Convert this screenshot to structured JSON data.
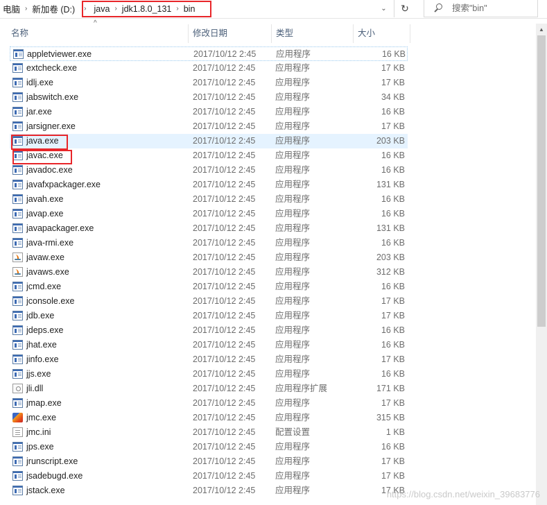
{
  "address": {
    "crumbs": [
      "电脑",
      "新加卷 (D:)",
      "java",
      "jdk1.8.0_131",
      "bin"
    ],
    "dropdown_glyph": "⌄",
    "refresh_glyph": "↻"
  },
  "search": {
    "placeholder": "搜索\"bin\""
  },
  "columns": {
    "name": "名称",
    "date": "修改日期",
    "type": "类型",
    "size": "大小"
  },
  "files": [
    {
      "name": "appletviewer.exe",
      "date": "2017/10/12 2:45",
      "type": "应用程序",
      "size": "16 KB",
      "icon": "exe-icon"
    },
    {
      "name": "extcheck.exe",
      "date": "2017/10/12 2:45",
      "type": "应用程序",
      "size": "17 KB",
      "icon": "exe-icon"
    },
    {
      "name": "idlj.exe",
      "date": "2017/10/12 2:45",
      "type": "应用程序",
      "size": "17 KB",
      "icon": "exe-icon"
    },
    {
      "name": "jabswitch.exe",
      "date": "2017/10/12 2:45",
      "type": "应用程序",
      "size": "34 KB",
      "icon": "exe-icon"
    },
    {
      "name": "jar.exe",
      "date": "2017/10/12 2:45",
      "type": "应用程序",
      "size": "16 KB",
      "icon": "exe-icon"
    },
    {
      "name": "jarsigner.exe",
      "date": "2017/10/12 2:45",
      "type": "应用程序",
      "size": "17 KB",
      "icon": "exe-icon"
    },
    {
      "name": "java.exe",
      "date": "2017/10/12 2:45",
      "type": "应用程序",
      "size": "203 KB",
      "icon": "exe-icon"
    },
    {
      "name": "javac.exe",
      "date": "2017/10/12 2:45",
      "type": "应用程序",
      "size": "16 KB",
      "icon": "exe-icon"
    },
    {
      "name": "javadoc.exe",
      "date": "2017/10/12 2:45",
      "type": "应用程序",
      "size": "16 KB",
      "icon": "exe-icon"
    },
    {
      "name": "javafxpackager.exe",
      "date": "2017/10/12 2:45",
      "type": "应用程序",
      "size": "131 KB",
      "icon": "exe-icon"
    },
    {
      "name": "javah.exe",
      "date": "2017/10/12 2:45",
      "type": "应用程序",
      "size": "16 KB",
      "icon": "exe-icon"
    },
    {
      "name": "javap.exe",
      "date": "2017/10/12 2:45",
      "type": "应用程序",
      "size": "16 KB",
      "icon": "exe-icon"
    },
    {
      "name": "javapackager.exe",
      "date": "2017/10/12 2:45",
      "type": "应用程序",
      "size": "131 KB",
      "icon": "exe-icon"
    },
    {
      "name": "java-rmi.exe",
      "date": "2017/10/12 2:45",
      "type": "应用程序",
      "size": "16 KB",
      "icon": "exe-icon"
    },
    {
      "name": "javaw.exe",
      "date": "2017/10/12 2:45",
      "type": "应用程序",
      "size": "203 KB",
      "icon": "java-icon"
    },
    {
      "name": "javaws.exe",
      "date": "2017/10/12 2:45",
      "type": "应用程序",
      "size": "312 KB",
      "icon": "java-icon"
    },
    {
      "name": "jcmd.exe",
      "date": "2017/10/12 2:45",
      "type": "应用程序",
      "size": "16 KB",
      "icon": "exe-icon"
    },
    {
      "name": "jconsole.exe",
      "date": "2017/10/12 2:45",
      "type": "应用程序",
      "size": "17 KB",
      "icon": "exe-icon"
    },
    {
      "name": "jdb.exe",
      "date": "2017/10/12 2:45",
      "type": "应用程序",
      "size": "17 KB",
      "icon": "exe-icon"
    },
    {
      "name": "jdeps.exe",
      "date": "2017/10/12 2:45",
      "type": "应用程序",
      "size": "16 KB",
      "icon": "exe-icon"
    },
    {
      "name": "jhat.exe",
      "date": "2017/10/12 2:45",
      "type": "应用程序",
      "size": "16 KB",
      "icon": "exe-icon"
    },
    {
      "name": "jinfo.exe",
      "date": "2017/10/12 2:45",
      "type": "应用程序",
      "size": "17 KB",
      "icon": "exe-icon"
    },
    {
      "name": "jjs.exe",
      "date": "2017/10/12 2:45",
      "type": "应用程序",
      "size": "16 KB",
      "icon": "exe-icon"
    },
    {
      "name": "jli.dll",
      "date": "2017/10/12 2:45",
      "type": "应用程序扩展",
      "size": "171 KB",
      "icon": "dll-icon"
    },
    {
      "name": "jmap.exe",
      "date": "2017/10/12 2:45",
      "type": "应用程序",
      "size": "17 KB",
      "icon": "exe-icon"
    },
    {
      "name": "jmc.exe",
      "date": "2017/10/12 2:45",
      "type": "应用程序",
      "size": "315 KB",
      "icon": "jmc-icon"
    },
    {
      "name": "jmc.ini",
      "date": "2017/10/12 2:45",
      "type": "配置设置",
      "size": "1 KB",
      "icon": "ini-icon"
    },
    {
      "name": "jps.exe",
      "date": "2017/10/12 2:45",
      "type": "应用程序",
      "size": "16 KB",
      "icon": "exe-icon"
    },
    {
      "name": "jrunscript.exe",
      "date": "2017/10/12 2:45",
      "type": "应用程序",
      "size": "17 KB",
      "icon": "exe-icon"
    },
    {
      "name": "jsadebugd.exe",
      "date": "2017/10/12 2:45",
      "type": "应用程序",
      "size": "17 KB",
      "icon": "exe-icon"
    },
    {
      "name": "jstack.exe",
      "date": "2017/10/12 2:45",
      "type": "应用程序",
      "size": "17 KB",
      "icon": "exe-icon"
    }
  ],
  "watermark": "https://blog.csdn.net/weixin_39683776",
  "colors": {
    "highlight_border": "#e8262a",
    "selected_row": "#e5f3ff",
    "header_text": "#4c607a"
  }
}
